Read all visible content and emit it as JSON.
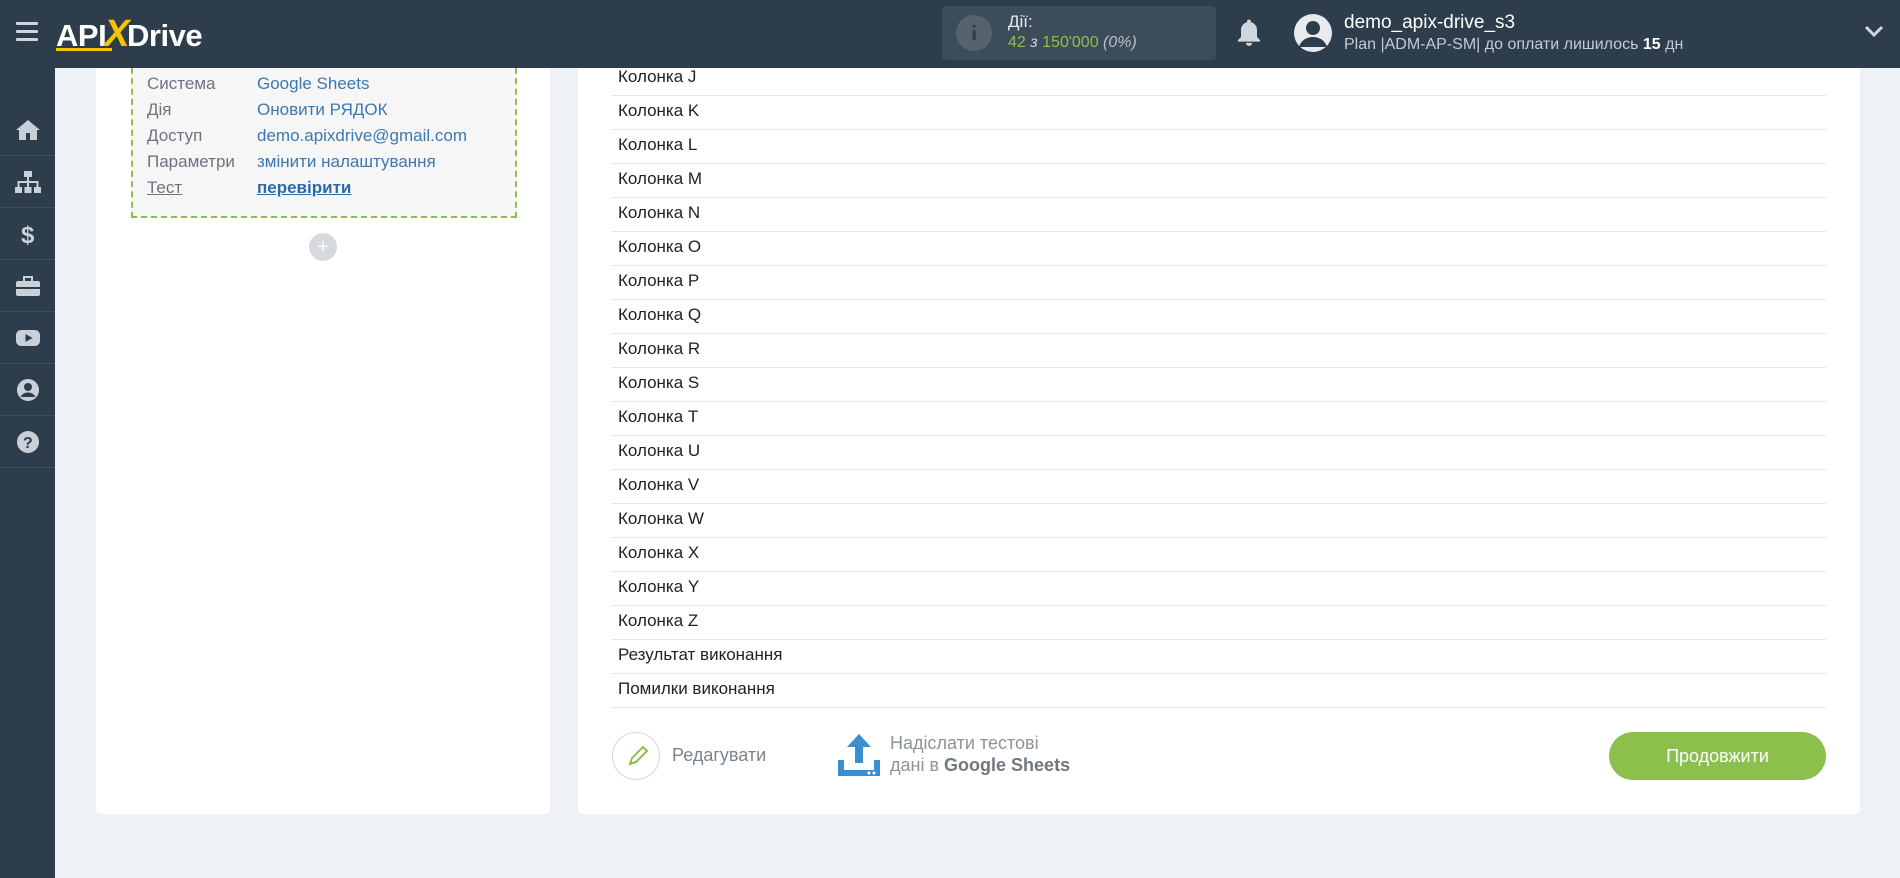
{
  "topbar": {
    "logo_left": "API",
    "logo_x": "X",
    "logo_right": "Drive",
    "actions_label": "Дії:",
    "actions_used": "42",
    "actions_of": "з",
    "actions_total": "150'000",
    "actions_pct": "(0%)",
    "user_name": "demo_apix-drive_s3",
    "plan_prefix": "Plan |ADM-AP-SM| до оплати лишилось",
    "plan_days": "15",
    "plan_suffix": "дн"
  },
  "sidebar": {
    "icons": [
      "home-icon",
      "sitemap-icon",
      "dollar-icon",
      "briefcase-icon",
      "youtube-icon",
      "user-circle-icon",
      "help-icon"
    ]
  },
  "connection": {
    "rows": [
      {
        "key": "Система",
        "value": "Google Sheets"
      },
      {
        "key": "Дія",
        "value": "Оновити РЯДОК"
      },
      {
        "key": "Доступ",
        "value": "demo.apixdrive@gmail.com"
      },
      {
        "key": "Параметри",
        "value": "змінити налаштування"
      },
      {
        "key": "Тест",
        "value": "перевірити"
      }
    ],
    "add_label": "+"
  },
  "columns": [
    "Колонка J",
    "Колонка K",
    "Колонка L",
    "Колонка M",
    "Колонка N",
    "Колонка O",
    "Колонка P",
    "Колонка Q",
    "Колонка R",
    "Колонка S",
    "Колонка T",
    "Колонка U",
    "Колонка V",
    "Колонка W",
    "Колонка X",
    "Колонка Y",
    "Колонка Z",
    "Результат виконання",
    "Помилки виконання"
  ],
  "footer": {
    "edit_label": "Редагувати",
    "upload_line1": "Надіслати тестові",
    "upload_line2_prefix": "дані в",
    "upload_line2_bold": "Google Sheets",
    "continue_label": "Продовжити"
  },
  "colors": {
    "topbar": "#2e3d4b",
    "accent_green": "#8cc04c",
    "link_blue": "#3b78b3",
    "logo_yellow": "#f5c400"
  }
}
